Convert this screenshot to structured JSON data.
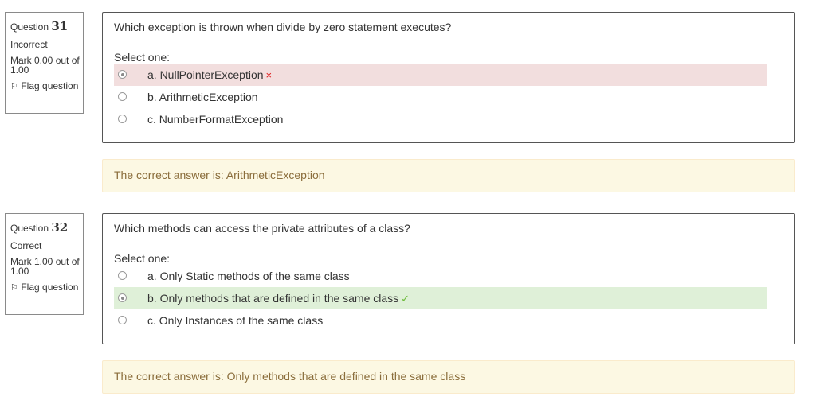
{
  "questions": [
    {
      "label": "Question",
      "number": "31",
      "state": "Incorrect",
      "grade": "Mark 0.00 out of 1.00",
      "flag_icon": "flag-icon",
      "flag_label": "Flag question",
      "text": "Which exception is thrown when divide by zero statement executes?",
      "prompt": "Select one:",
      "answers": [
        {
          "label": "a. NullPointerException",
          "selected": true,
          "status": "incorrect",
          "mark": "×"
        },
        {
          "label": "b. ArithmeticException",
          "selected": false,
          "status": "",
          "mark": ""
        },
        {
          "label": "c. NumberFormatException",
          "selected": false,
          "status": "",
          "mark": ""
        }
      ],
      "feedback": "The correct answer is: ArithmeticException"
    },
    {
      "label": "Question",
      "number": "32",
      "state": "Correct",
      "grade": "Mark 1.00 out of 1.00",
      "flag_icon": "flag-icon",
      "flag_label": "Flag question",
      "text": "Which methods can access the private attributes of a class?",
      "prompt": "Select one:",
      "answers": [
        {
          "label": "a. Only Static methods of the same class",
          "selected": false,
          "status": "",
          "mark": ""
        },
        {
          "label": "b. Only methods that are defined in the same class",
          "selected": true,
          "status": "correct",
          "mark": "✓"
        },
        {
          "label": "c. Only Instances of the same class",
          "selected": false,
          "status": "",
          "mark": ""
        }
      ],
      "feedback": "The correct answer is: Only methods that are defined in the same class"
    }
  ],
  "colors": {
    "incorrect_bg": "#f2dede",
    "correct_bg": "#dff0d8",
    "feedback_bg": "#fcf8e3",
    "feedback_text": "#8a6d3b",
    "incorrect_mark": "#e01e1e",
    "correct_mark": "#6dbb3a"
  }
}
